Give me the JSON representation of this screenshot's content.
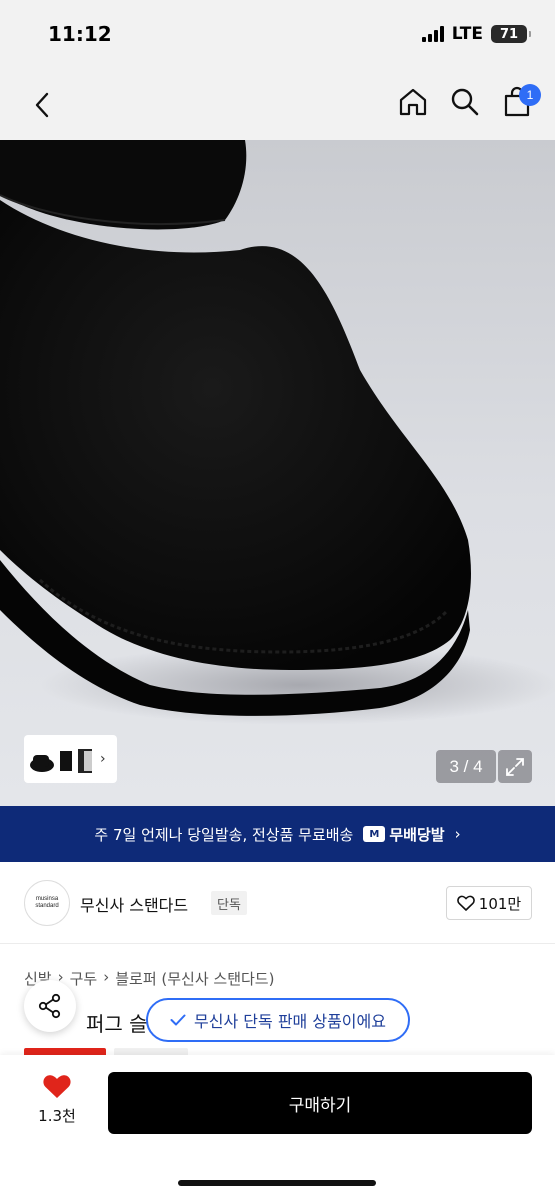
{
  "status_bar": {
    "time": "11:12",
    "network": "LTE",
    "battery": "71"
  },
  "nav": {
    "cart_count": "1",
    "icons": [
      "back-icon",
      "home-icon",
      "search-icon",
      "cart-icon"
    ]
  },
  "gallery": {
    "page_counter": "3 / 4",
    "current_page": 3,
    "total_pages": 4
  },
  "shipping_banner": {
    "text": "주 7일 언제나 당일발송, 전상품 무료배송",
    "logo_mark": "M",
    "logo_text": "무배당발",
    "chevron": "›"
  },
  "brand": {
    "logo_line1": "musinsa",
    "logo_line2": "standard",
    "name": "무신사 스탠다드",
    "badge": "단독",
    "likes": "101만"
  },
  "breadcrumb": [
    "신발",
    "구두",
    "블로퍼 (무신사 스탠다드)"
  ],
  "breadcrumb_sep": "›",
  "product": {
    "title_visible": "퍼그 슬"
  },
  "tooltip": {
    "text": "무신사 단독 판매 상품이에요"
  },
  "bottom_bar": {
    "wish_count": "1.3천",
    "buy_label": "구매하기"
  },
  "colors": {
    "banner": "#0e2a78",
    "accent_blue": "#2f6df6",
    "heart_red": "#e0251b",
    "buy_button": "#000000"
  }
}
